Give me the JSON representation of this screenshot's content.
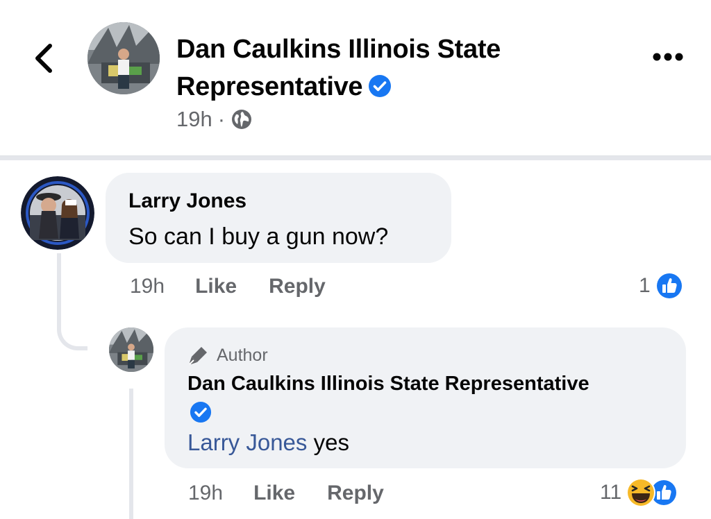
{
  "post": {
    "page_name": "Dan Caulkins Illinois State Representative",
    "timestamp": "19h",
    "audience_icon": "globe-icon",
    "back_icon": "chevron-left-icon",
    "more_icon": "more-dots-icon"
  },
  "comments": [
    {
      "author": "Larry Jones",
      "text": "So can I buy a gun now?",
      "time": "19h",
      "like_label": "Like",
      "reply_label": "Reply",
      "reaction_count": "1",
      "reactions": [
        "like-icon"
      ],
      "replies": [
        {
          "badge": "Author",
          "badge_icon": "pen-icon",
          "author": "Dan Caulkins Illinois State Representative",
          "verified": true,
          "mention": "Larry Jones",
          "text": "yes",
          "time": "19h",
          "like_label": "Like",
          "reply_label": "Reply",
          "reaction_count": "11",
          "reactions": [
            "haha-icon",
            "like-icon"
          ]
        }
      ]
    }
  ],
  "colors": {
    "accent": "#1877f2",
    "mention": "#385898",
    "bubble": "#f0f2f5",
    "secondary_text": "#65676b",
    "haha": "#f7b928"
  }
}
